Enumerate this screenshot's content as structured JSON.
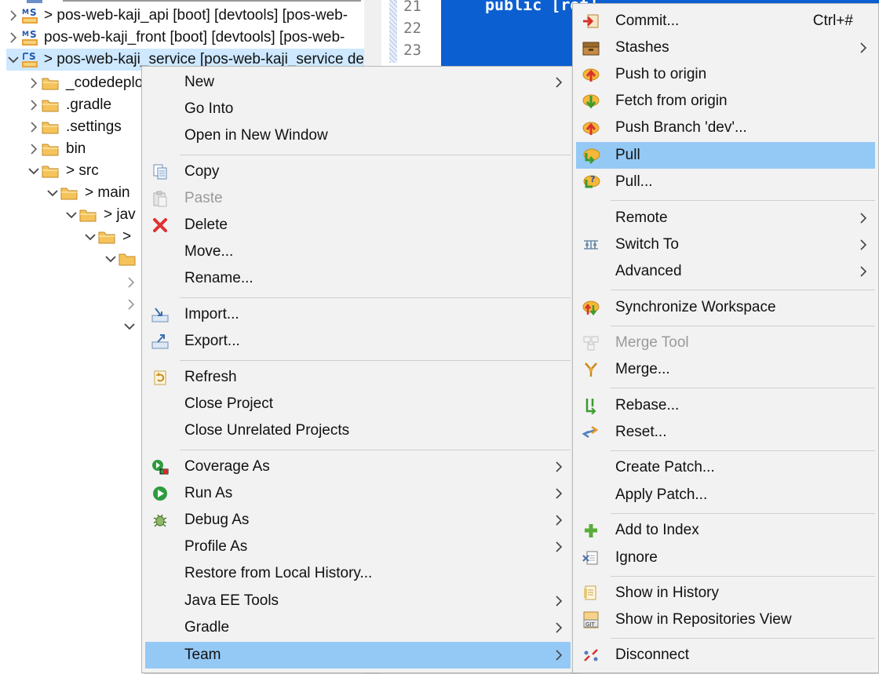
{
  "tree": {
    "items": [
      {
        "label": "> pos-web-kaji_api [boot] [devtools] [pos-web-",
        "icon": "spring-project-icon"
      },
      {
        "label": "pos-web-kaji_front [boot] [devtools] [pos-web-",
        "icon": "spring-project-icon"
      },
      {
        "label": "> pos-web-kaji_service [pos-web-kaji_service de",
        "icon": "git-project-icon"
      },
      {
        "label": "_codedeplo",
        "icon": "folder-icon"
      },
      {
        "label": ".gradle",
        "icon": "folder-icon"
      },
      {
        "label": ".settings",
        "icon": "folder-icon"
      },
      {
        "label": "bin",
        "icon": "folder-icon"
      },
      {
        "label": "> src",
        "icon": "folder-icon"
      },
      {
        "label": "> main",
        "icon": "folder-icon"
      },
      {
        "label": "> jav",
        "icon": "folder-icon"
      },
      {
        "label": ">",
        "icon": "folder-icon"
      }
    ]
  },
  "editor": {
    "line_numbers": [
      "21",
      "22",
      "23"
    ],
    "code": "public [ret]"
  },
  "context_menu": {
    "items": [
      {
        "label": "New",
        "submenu": true
      },
      {
        "label": "Go Into"
      },
      {
        "label": "Open in New Window"
      },
      {
        "label": "Copy",
        "icon": "copy-icon"
      },
      {
        "label": "Paste",
        "icon": "paste-icon",
        "disabled": true
      },
      {
        "label": "Delete",
        "icon": "delete-icon"
      },
      {
        "label": "Move..."
      },
      {
        "label": "Rename..."
      },
      {
        "label": "Import...",
        "icon": "import-icon"
      },
      {
        "label": "Export...",
        "icon": "export-icon"
      },
      {
        "label": "Refresh",
        "icon": "refresh-icon"
      },
      {
        "label": "Close Project"
      },
      {
        "label": "Close Unrelated Projects"
      },
      {
        "label": "Coverage As",
        "icon": "coverage-icon",
        "submenu": true
      },
      {
        "label": "Run As",
        "icon": "run-icon",
        "submenu": true
      },
      {
        "label": "Debug As",
        "icon": "debug-icon",
        "submenu": true
      },
      {
        "label": "Profile As",
        "submenu": true
      },
      {
        "label": "Restore from Local History..."
      },
      {
        "label": "Java EE Tools",
        "submenu": true
      },
      {
        "label": "Gradle",
        "submenu": true
      },
      {
        "label": "Team",
        "submenu": true,
        "highlighted": true
      }
    ]
  },
  "team_menu": {
    "items": [
      {
        "label": "Commit...",
        "icon": "commit-icon",
        "accel": "Ctrl+#"
      },
      {
        "label": "Stashes",
        "icon": "stashes-icon",
        "submenu": true
      },
      {
        "label": "Push to origin",
        "icon": "push-icon"
      },
      {
        "label": "Fetch from origin",
        "icon": "fetch-icon"
      },
      {
        "label": "Push Branch 'dev'...",
        "icon": "push-branch-icon"
      },
      {
        "label": "Pull",
        "icon": "pull-icon",
        "highlighted": true
      },
      {
        "label": "Pull...",
        "icon": "pull-dialog-icon"
      },
      {
        "label": "Remote",
        "submenu": true
      },
      {
        "label": "Switch To",
        "icon": "switch-branch-icon",
        "submenu": true
      },
      {
        "label": "Advanced",
        "submenu": true
      },
      {
        "label": "Synchronize Workspace",
        "icon": "synchronize-icon"
      },
      {
        "label": "Merge Tool",
        "icon": "merge-tool-icon",
        "disabled": true
      },
      {
        "label": "Merge...",
        "icon": "merge-icon"
      },
      {
        "label": "Rebase...",
        "icon": "rebase-icon"
      },
      {
        "label": "Reset...",
        "icon": "reset-icon"
      },
      {
        "label": "Create Patch..."
      },
      {
        "label": "Apply Patch..."
      },
      {
        "label": "Add to Index",
        "icon": "add-to-index-icon"
      },
      {
        "label": "Ignore",
        "icon": "ignore-icon"
      },
      {
        "label": "Show in History",
        "icon": "history-icon"
      },
      {
        "label": "Show in Repositories View",
        "icon": "repositories-icon"
      },
      {
        "label": "Disconnect",
        "icon": "disconnect-icon"
      }
    ]
  },
  "colors": {
    "menu_bg": "#f2f2f2",
    "highlight": "#95c9f5",
    "tree_selection": "#cde8ff",
    "editor_selection": "#0b5fd0"
  }
}
